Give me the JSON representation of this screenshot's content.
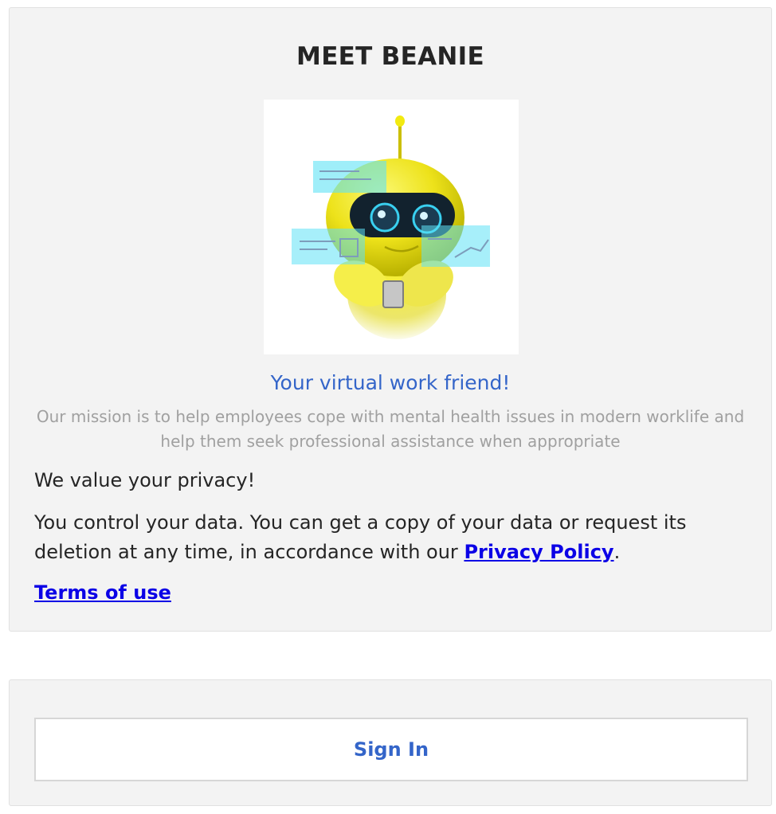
{
  "card": {
    "title": "MEET BEANIE",
    "hero_image": "robot-mascot-illustration",
    "tagline": "Your virtual work friend!",
    "mission": "Our mission is to help employees cope with mental health issues in modern worklife and help them seek professional assistance when appropriate",
    "privacy_heading": "We value your privacy!",
    "privacy_text_before": "You control your data. You can get a copy of your data or request its deletion at any time, in accordance with our ",
    "privacy_link": "Privacy Policy",
    "privacy_text_after": ".",
    "terms_link": "Terms of use"
  },
  "signin": {
    "label": "Sign In"
  },
  "colors": {
    "card_bg": "#f3f3f3",
    "accent": "#3465c9",
    "link": "#0b00e6",
    "muted": "#a0a0a0",
    "robot_yellow": "#f2ec1c"
  }
}
